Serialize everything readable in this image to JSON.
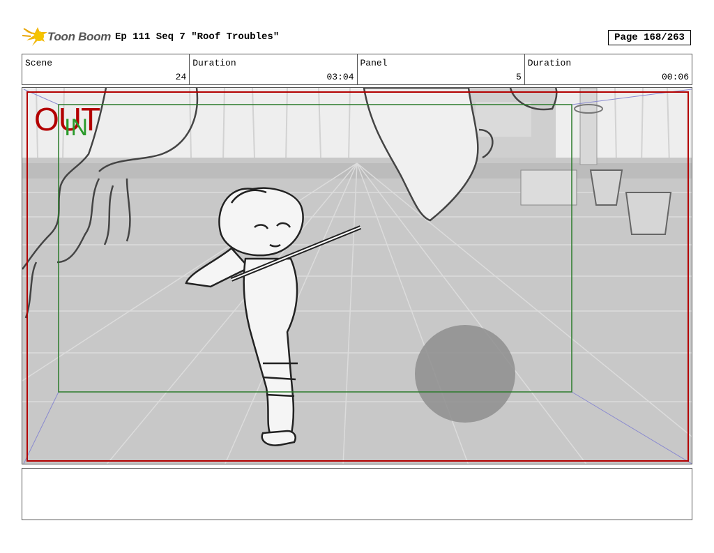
{
  "header": {
    "logo_alt": "Toon Boom",
    "logo_text": "Toon Boom",
    "episode_title": "Ep 111 Seq 7 \"Roof Troubles\"",
    "page": "Page 168/263"
  },
  "info": {
    "scene_label": "Scene",
    "scene_value": "24",
    "scene_duration_label": "Duration",
    "scene_duration_value": "03:04",
    "panel_label": "Panel",
    "panel_value": "5",
    "panel_duration_label": "Duration",
    "panel_duration_value": "00:06"
  },
  "panel": {
    "out_label": "OUT",
    "in_label": "IN"
  },
  "notes": {
    "text": ""
  },
  "colors": {
    "out_frame": "#b30000",
    "in_frame": "#2a7a2a",
    "camera_guides": "#8a8ad0"
  }
}
